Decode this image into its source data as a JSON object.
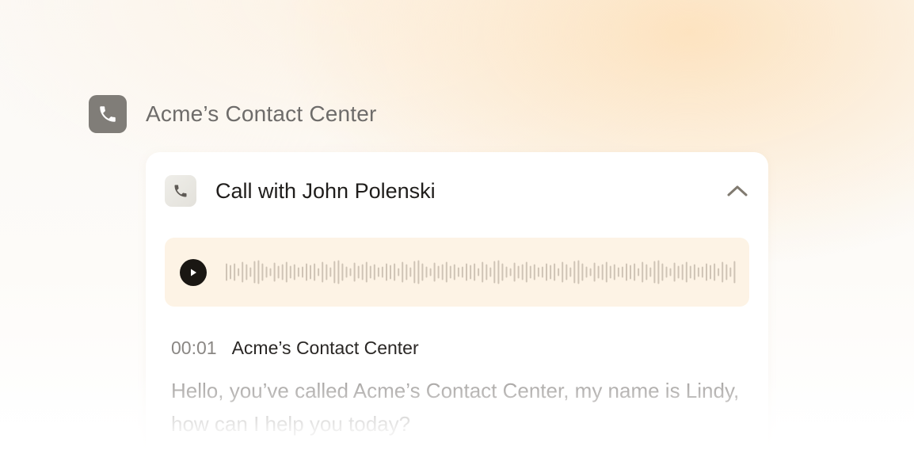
{
  "header": {
    "app_icon": "phone-icon",
    "title": "Acme’s Contact Center"
  },
  "call_card": {
    "icon": "phone-icon",
    "title": "Call with John Polenski",
    "collapse_icon": "chevron-up-icon",
    "player": {
      "play_icon": "play-icon",
      "background_color": "#fdf3e5",
      "button_color": "#1a1713",
      "waveform_color": "#cfc4b6"
    },
    "transcript": [
      {
        "timestamp": "00:01",
        "speaker": "Acme’s Contact Center",
        "text": "Hello, you’ve called Acme’s Contact Center, my name is Lindy, how can I help you today?"
      }
    ]
  },
  "colors": {
    "app_icon_bg": "#807d78",
    "accent_glow": "#fde3c0"
  }
}
